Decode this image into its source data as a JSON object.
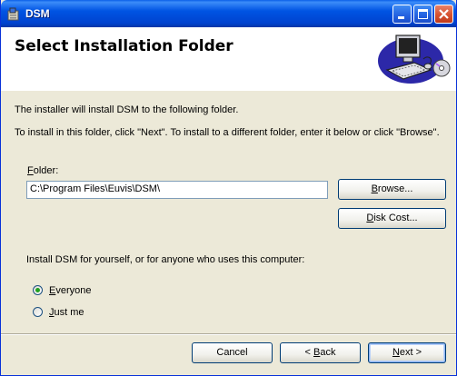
{
  "window": {
    "title": "DSM"
  },
  "header": {
    "title": "Select Installation Folder"
  },
  "body": {
    "line1": "The installer will install DSM to the following folder.",
    "line2": "To install in this folder, click \"Next\". To install to a different folder, enter it below or click \"Browse\"."
  },
  "folder": {
    "label_first": "F",
    "label_rest": "older:",
    "value": "C:\\Program Files\\Euvis\\DSM\\"
  },
  "buttons": {
    "browse_first": "B",
    "browse_rest": "rowse...",
    "disk_first": "D",
    "disk_rest": "isk Cost...",
    "cancel": "Cancel",
    "back_pre": "< ",
    "back_first": "B",
    "back_rest": "ack",
    "next_first": "N",
    "next_rest": "ext >"
  },
  "install_for": {
    "question": "Install DSM for yourself, or for anyone who uses this computer:",
    "options": [
      {
        "first": "E",
        "rest": "veryone",
        "selected": true
      },
      {
        "first": "",
        "u": "J",
        "rest": "ust me",
        "selected": false
      }
    ]
  }
}
